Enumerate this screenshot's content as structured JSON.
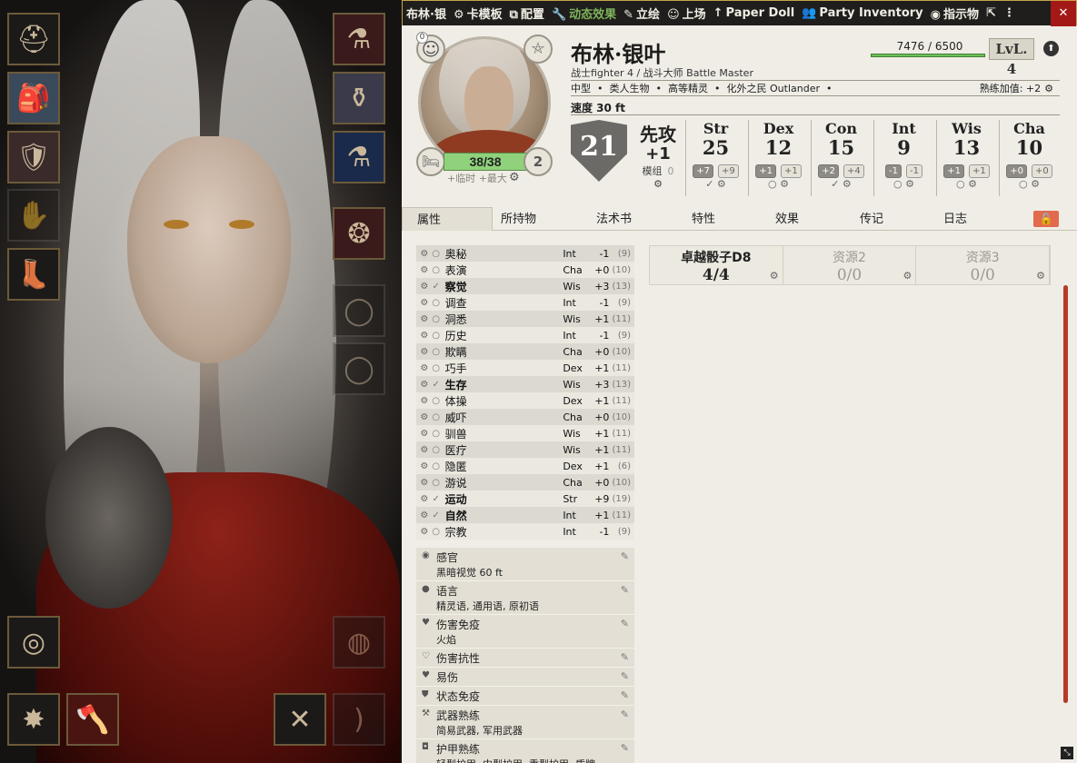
{
  "titlebar": {
    "name": "布林·银",
    "template": "卡模板",
    "config": "配置",
    "dynamic": "动态效果",
    "portrait": "立绘",
    "token": "上场",
    "paperdoll": "Paper Doll",
    "party": "Party Inventory",
    "owner": "指示物"
  },
  "character": {
    "name": "布林·银叶",
    "class_line": "战士fighter 4 / 战斗大师 Battle Master",
    "xp": "7476 / 6500",
    "level": "LvL. 4",
    "size": "中型",
    "type": "类人生物",
    "race": "高等精灵",
    "background": "化外之民 Outlander",
    "prof_bonus": "熟练加值: +2",
    "speed": "速度 30 ft",
    "hp": "38/38",
    "hp_sub": "+临时  +最大",
    "temp_count": "0",
    "hit_dice": "2",
    "ac": "21",
    "init_label": "先攻",
    "init_value": "+1",
    "init_mod": "模组",
    "init_mod_val": "0"
  },
  "abilities": [
    {
      "name": "Str",
      "value": "25",
      "mod": "+7",
      "save": "+9",
      "prof": "✓"
    },
    {
      "name": "Dex",
      "value": "12",
      "mod": "+1",
      "save": "+1",
      "prof": "○"
    },
    {
      "name": "Con",
      "value": "15",
      "mod": "+2",
      "save": "+4",
      "prof": "✓"
    },
    {
      "name": "Int",
      "value": "9",
      "mod": "-1",
      "save": "-1",
      "prof": "○"
    },
    {
      "name": "Wis",
      "value": "13",
      "mod": "+1",
      "save": "+1",
      "prof": "○"
    },
    {
      "name": "Cha",
      "value": "10",
      "mod": "+0",
      "save": "+0",
      "prof": "○"
    }
  ],
  "tabs": [
    "属性",
    "所持物",
    "法术书",
    "特性",
    "效果",
    "传记",
    "日志"
  ],
  "skills": [
    {
      "name": "奥秘",
      "ab": "Int",
      "mod": "-1",
      "pass": "(9)",
      "p": "○"
    },
    {
      "name": "表演",
      "ab": "Cha",
      "mod": "+0",
      "pass": "(10)",
      "p": "○"
    },
    {
      "name": "察觉",
      "ab": "Wis",
      "mod": "+3",
      "pass": "(13)",
      "p": "✓"
    },
    {
      "name": "调查",
      "ab": "Int",
      "mod": "-1",
      "pass": "(9)",
      "p": "○"
    },
    {
      "name": "洞悉",
      "ab": "Wis",
      "mod": "+1",
      "pass": "(11)",
      "p": "○"
    },
    {
      "name": "历史",
      "ab": "Int",
      "mod": "-1",
      "pass": "(9)",
      "p": "○"
    },
    {
      "name": "欺瞒",
      "ab": "Cha",
      "mod": "+0",
      "pass": "(10)",
      "p": "○"
    },
    {
      "name": "巧手",
      "ab": "Dex",
      "mod": "+1",
      "pass": "(11)",
      "p": "○"
    },
    {
      "name": "生存",
      "ab": "Wis",
      "mod": "+3",
      "pass": "(13)",
      "p": "✓"
    },
    {
      "name": "体操",
      "ab": "Dex",
      "mod": "+1",
      "pass": "(11)",
      "p": "○"
    },
    {
      "name": "威吓",
      "ab": "Cha",
      "mod": "+0",
      "pass": "(10)",
      "p": "○"
    },
    {
      "name": "驯兽",
      "ab": "Wis",
      "mod": "+1",
      "pass": "(11)",
      "p": "○"
    },
    {
      "name": "医疗",
      "ab": "Wis",
      "mod": "+1",
      "pass": "(11)",
      "p": "○"
    },
    {
      "name": "隐匿",
      "ab": "Dex",
      "mod": "+1",
      "pass": "(6)",
      "p": "○"
    },
    {
      "name": "游说",
      "ab": "Cha",
      "mod": "+0",
      "pass": "(10)",
      "p": "○"
    },
    {
      "name": "运动",
      "ab": "Str",
      "mod": "+9",
      "pass": "(19)",
      "p": "✓"
    },
    {
      "name": "自然",
      "ab": "Int",
      "mod": "+1",
      "pass": "(11)",
      "p": "✓"
    },
    {
      "name": "宗教",
      "ab": "Int",
      "mod": "-1",
      "pass": "(9)",
      "p": "○"
    }
  ],
  "traits": [
    {
      "label": "感官",
      "value": "黑暗视觉 60 ft",
      "icon": "eye-icon",
      "glyph": "◉"
    },
    {
      "label": "语言",
      "value": "精灵语, 通用语, 原初语",
      "icon": "speech-icon",
      "glyph": "●"
    },
    {
      "label": "伤害免疫",
      "value": "火焰",
      "icon": "heart-icon",
      "glyph": "♥"
    },
    {
      "label": "伤害抗性",
      "value": "",
      "icon": "heart-outline-icon",
      "glyph": "♡"
    },
    {
      "label": "易伤",
      "value": "",
      "icon": "heart-icon",
      "glyph": "♥"
    },
    {
      "label": "状态免疫",
      "value": "",
      "icon": "shield-icon",
      "glyph": "⛊"
    },
    {
      "label": "武器熟练",
      "value": "简易武器, 军用武器",
      "icon": "weapon-icon",
      "glyph": "⚒"
    },
    {
      "label": "护甲熟练",
      "value": "轻型护甲, 中型护甲, 重型护甲, 盾牌",
      "icon": "armor-icon",
      "glyph": "◘"
    }
  ],
  "resources": [
    {
      "name": "卓越骰子D8",
      "value": "4/4"
    },
    {
      "name": "资源2",
      "value": "0/0"
    },
    {
      "name": "资源3",
      "value": "0/0"
    }
  ]
}
